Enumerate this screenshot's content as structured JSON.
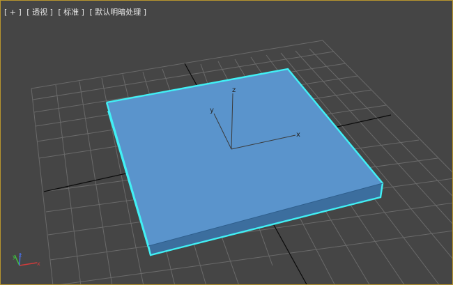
{
  "viewport": {
    "menus": [
      {
        "label": "[ + ]"
      },
      {
        "label": "[ 透视 ]"
      },
      {
        "label": "[ 标准 ]"
      },
      {
        "label": "[ 默认明暗处理 ]"
      }
    ]
  },
  "gizmo": {
    "x": "x",
    "y": "y",
    "z": "z"
  },
  "corner_axes": {
    "x": "x",
    "y": "y",
    "z": "z"
  },
  "colors": {
    "background": "#454545",
    "grid": "#6a6a6a",
    "grid_main": "#0a0a0a",
    "box_top": "#5a94cc",
    "box_side": "#3c6e9e",
    "selection": "#41f0f5",
    "border": "#b8962e"
  }
}
